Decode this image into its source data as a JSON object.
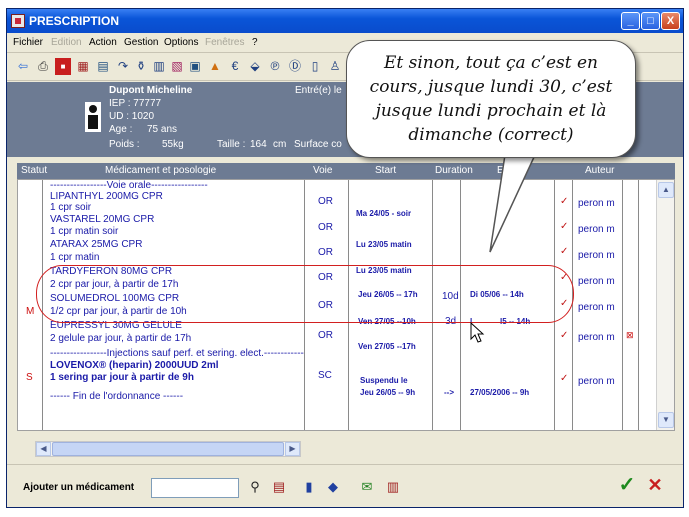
{
  "window": {
    "title": "PRESCRIPTION",
    "controls": {
      "minimize": "_",
      "maximize": "□",
      "close": "X"
    }
  },
  "menu": [
    "Fichier",
    "Edition",
    "Action",
    "Gestion",
    "Options",
    "Fenêtres",
    "?"
  ],
  "patient": {
    "name": "Dupont Micheline",
    "iep": "IEP : 77777",
    "ud": "UD :  1020",
    "age_label": "Age :",
    "age_value": "75 ans",
    "weight_label": "Poids :",
    "weight_value": "55kg",
    "height_label": "Taille :",
    "height_value": "164",
    "height_unit": "cm",
    "surface_label": "Surface co",
    "entry_label": "Entré(e) le"
  },
  "columns": [
    "Statut",
    "Médicament et posologie",
    "Voie",
    "Start",
    "Duration",
    "End",
    "Auteur"
  ],
  "rows": [
    {
      "med": "-----------------Voie orale-----------------"
    },
    {
      "med": "LIPANTHYL 200MG CPR",
      "voie": "OR",
      "start": "Ma 24/05 - soir",
      "auteur": "peron m",
      "check": "✓"
    },
    {
      "med": "  1 cpr soir"
    },
    {
      "med": "VASTAREL 20MG CPR",
      "voie": "OR",
      "start": "Lu 23/05  matin",
      "auteur": "peron m",
      "check": "✓"
    },
    {
      "med": "  1 cpr matin soir"
    },
    {
      "med": "ATARAX 25MG CPR",
      "voie": "OR",
      "start": "Lu 23/05  matin",
      "auteur": "peron m",
      "check": "✓"
    },
    {
      "med": "  1 cpr matin"
    },
    {
      "med": "TARDYFERON 80MG CPR",
      "voie": "OR",
      "start": "Jeu 26/05 -- 17h",
      "duration": "10d",
      "end": "Di 05/06 -- 14h",
      "auteur": "peron m",
      "check": "✓"
    },
    {
      "med": "  2 cpr par jour,  à partir de 17h"
    },
    {
      "status": "M",
      "med": "SOLUMEDROL 100MG CPR",
      "voie": "OR",
      "start": "Ven 27/05 --10h",
      "duration": "3d",
      "end_a": "l",
      "end_b": "l5 -- 14h",
      "auteur": "peron m",
      "check": "✓"
    },
    {
      "med": "  1/2 cpr par jour,  à partir de 10h"
    },
    {
      "med": "EUPRESSYL 30MG GELULE",
      "voie": "OR",
      "start": "Ven 27/05 --17h",
      "auteur": "peron m",
      "check": "✓",
      "flag": "⊠"
    },
    {
      "med": "  2 gelule par jour,  à partir de 17h"
    },
    {
      "med": "-----------------Injections sauf perf. et sering. elect.------------"
    },
    {
      "status": "S",
      "med": "LOVENOX® (heparin) 2000UUD 2ml",
      "voie": "SC",
      "start_a": "Suspendu le",
      "start_b": "Jeu 26/05 -- 9h",
      "duration": "-->",
      "end": "27/05/2006 -- 9h",
      "auteur": "peron m",
      "check": "✓"
    },
    {
      "med": "  1 sering par jour à partir de 9h"
    },
    {
      "med": "------  Fin de l'ordonnance  ------"
    }
  ],
  "bottom": {
    "add_label": "Ajouter un médicament",
    "ok_icon": "✓",
    "cancel_icon": "✕"
  },
  "callout": {
    "text": "Et sinon, tout ça c’est en cours, jusque lundi 30, c’est jusque lundi prochain et là dimanche (correct)"
  },
  "colors": {
    "titlebar": "#0a55d8",
    "header_bg": "#6d7b93",
    "text_blue": "#1a1aa8",
    "check_red": "#c01818",
    "oval_red": "#d22020"
  }
}
